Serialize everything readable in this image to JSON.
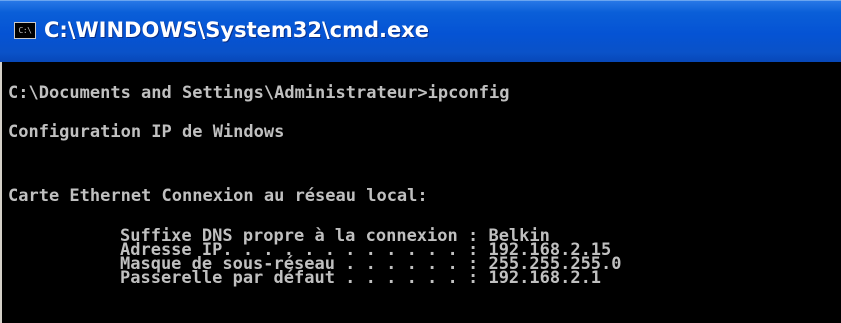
{
  "window": {
    "title": "C:\\WINDOWS\\System32\\cmd.exe",
    "icon_name": "cmd-app-icon",
    "icon_glyph": "C:\\"
  },
  "console": {
    "prompt_line": "C:\\Documents and Settings\\Administrateur>ipconfig",
    "header_line": "Configuration IP de Windows",
    "adapter_line": "Carte Ethernet Connexion au réseau local:",
    "detail_lines": [
      "Suffixe DNS propre à la connexion : Belkin",
      "Adresse IP. . . . . . . . . . . . : 192.168.2.15",
      "Masque de sous-réseau . . . . . . : 255.255.255.0",
      "Passerelle par défaut . . . . . . : 192.168.2.1"
    ]
  },
  "colors": {
    "titlebar": "#0553d4",
    "console_background": "#000000",
    "console_text": "#c0c0c0"
  }
}
